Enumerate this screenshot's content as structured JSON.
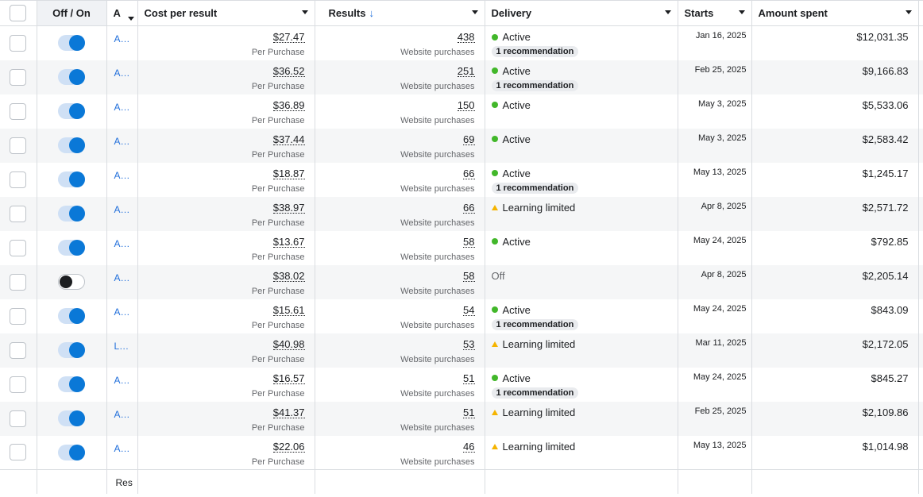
{
  "header": {
    "toggle_label": "Off / On",
    "name_label": "A",
    "cost_label": "Cost per result",
    "results_label": "Results",
    "results_sort_icon": "↓",
    "delivery_label": "Delivery",
    "starts_label": "Starts",
    "amount_label": "Amount spent"
  },
  "rows": [
    {
      "on": true,
      "name": "A…",
      "cost": "$27.47",
      "cost_sub": "Per Purchase",
      "results": "438",
      "results_sub": "Website purchases",
      "status": "Active",
      "status_kind": "active",
      "rec": "1 recommendation",
      "starts": "Jan 16, 2025",
      "spent": "$12,031.35"
    },
    {
      "on": true,
      "name": "A…",
      "cost": "$36.52",
      "cost_sub": "Per Purchase",
      "results": "251",
      "results_sub": "Website purchases",
      "status": "Active",
      "status_kind": "active",
      "rec": "1 recommendation",
      "starts": "Feb 25, 2025",
      "spent": "$9,166.83"
    },
    {
      "on": true,
      "name": "A…",
      "cost": "$36.89",
      "cost_sub": "Per Purchase",
      "results": "150",
      "results_sub": "Website purchases",
      "status": "Active",
      "status_kind": "active",
      "rec": "",
      "starts": "May 3, 2025",
      "spent": "$5,533.06"
    },
    {
      "on": true,
      "name": "A…",
      "cost": "$37.44",
      "cost_sub": "Per Purchase",
      "results": "69",
      "results_sub": "Website purchases",
      "status": "Active",
      "status_kind": "active",
      "rec": "",
      "starts": "May 3, 2025",
      "spent": "$2,583.42"
    },
    {
      "on": true,
      "name": "A…",
      "cost": "$18.87",
      "cost_sub": "Per Purchase",
      "results": "66",
      "results_sub": "Website purchases",
      "status": "Active",
      "status_kind": "active",
      "rec": "1 recommendation",
      "starts": "May 13, 2025",
      "spent": "$1,245.17"
    },
    {
      "on": true,
      "name": "A…",
      "cost": "$38.97",
      "cost_sub": "Per Purchase",
      "results": "66",
      "results_sub": "Website purchases",
      "status": "Learning limited",
      "status_kind": "learning",
      "rec": "",
      "starts": "Apr 8, 2025",
      "spent": "$2,571.72"
    },
    {
      "on": true,
      "name": "A…",
      "cost": "$13.67",
      "cost_sub": "Per Purchase",
      "results": "58",
      "results_sub": "Website purchases",
      "status": "Active",
      "status_kind": "active",
      "rec": "",
      "starts": "May 24, 2025",
      "spent": "$792.85"
    },
    {
      "on": false,
      "name": "A…",
      "cost": "$38.02",
      "cost_sub": "Per Purchase",
      "results": "58",
      "results_sub": "Website purchases",
      "status": "Off",
      "status_kind": "off",
      "rec": "",
      "starts": "Apr 8, 2025",
      "spent": "$2,205.14"
    },
    {
      "on": true,
      "name": "A…",
      "cost": "$15.61",
      "cost_sub": "Per Purchase",
      "results": "54",
      "results_sub": "Website purchases",
      "status": "Active",
      "status_kind": "active",
      "rec": "1 recommendation",
      "starts": "May 24, 2025",
      "spent": "$843.09"
    },
    {
      "on": true,
      "name": "L…",
      "cost": "$40.98",
      "cost_sub": "Per Purchase",
      "results": "53",
      "results_sub": "Website purchases",
      "status": "Learning limited",
      "status_kind": "learning",
      "rec": "",
      "starts": "Mar 11, 2025",
      "spent": "$2,172.05"
    },
    {
      "on": true,
      "name": "A…",
      "cost": "$16.57",
      "cost_sub": "Per Purchase",
      "results": "51",
      "results_sub": "Website purchases",
      "status": "Active",
      "status_kind": "active",
      "rec": "1 recommendation",
      "starts": "May 24, 2025",
      "spent": "$845.27"
    },
    {
      "on": true,
      "name": "A…",
      "cost": "$41.37",
      "cost_sub": "Per Purchase",
      "results": "51",
      "results_sub": "Website purchases",
      "status": "Learning limited",
      "status_kind": "learning",
      "rec": "",
      "starts": "Feb 25, 2025",
      "spent": "$2,109.86"
    },
    {
      "on": true,
      "name": "A…",
      "cost": "$22.06",
      "cost_sub": "Per Purchase",
      "results": "46",
      "results_sub": "Website purchases",
      "status": "Learning limited",
      "status_kind": "learning",
      "rec": "",
      "starts": "May 13, 2025",
      "spent": "$1,014.98"
    }
  ],
  "footer": {
    "label": "Res"
  }
}
